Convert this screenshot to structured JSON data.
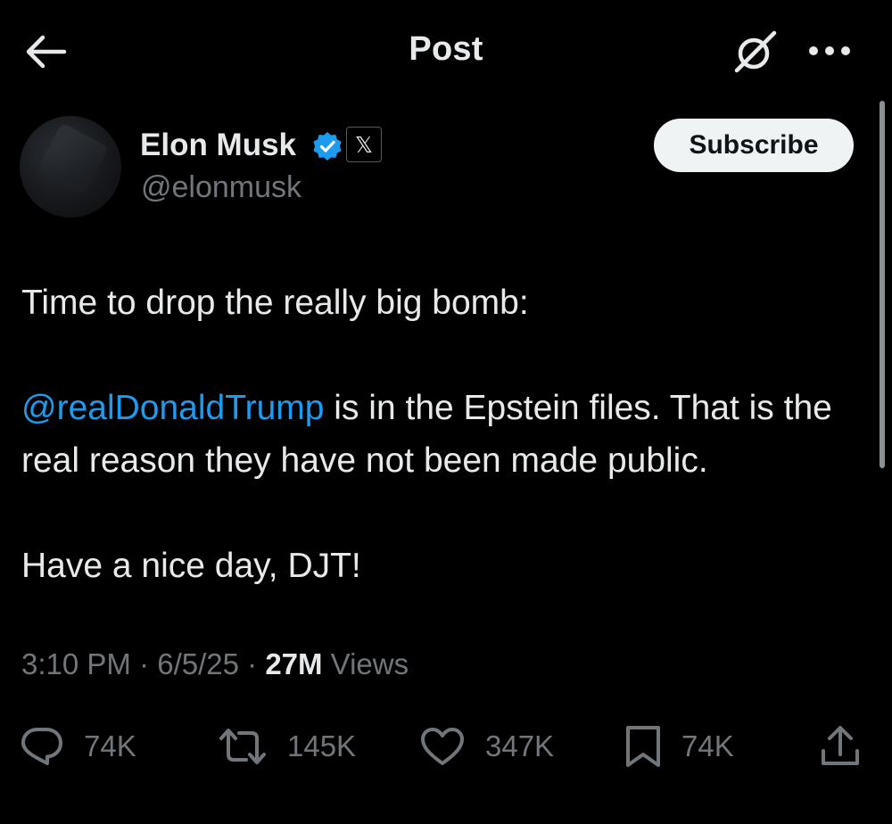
{
  "header": {
    "title": "Post",
    "back_icon": "arrow-left-icon",
    "grok_icon": "grok-icon",
    "more_icon": "more-horizontal-icon"
  },
  "author": {
    "name": "Elon Musk",
    "handle": "@elonmusk",
    "verified_icon": "verified-badge-icon",
    "verified_color": "#1d9bf0",
    "affiliation_glyph": "𝕏",
    "subscribe_label": "Subscribe"
  },
  "post": {
    "line1": "Time to drop the really big bomb:",
    "mention": "@realDonaldTrump",
    "line2_rest": " is in the Epstein files. That is the real reason they have not been made public.",
    "line3": "Have a nice day, DJT!",
    "mention_color": "#1d9bf0"
  },
  "meta": {
    "time": "3:10 PM",
    "sep1": " · ",
    "date": "6/5/25",
    "sep2": " · ",
    "views_count": "27M",
    "views_label": " Views"
  },
  "actions": {
    "replies": {
      "icon": "reply-icon",
      "count": "74K"
    },
    "reposts": {
      "icon": "repost-icon",
      "count": "145K"
    },
    "likes": {
      "icon": "like-icon",
      "count": "347K"
    },
    "bookmarks": {
      "icon": "bookmark-icon",
      "count": "74K"
    },
    "share": {
      "icon": "share-icon"
    }
  }
}
